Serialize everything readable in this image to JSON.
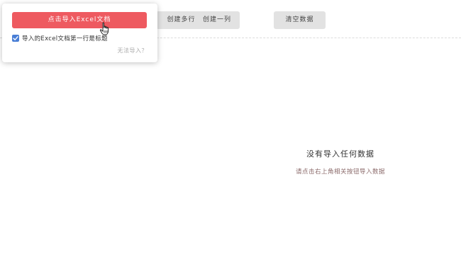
{
  "toolbar": {
    "buttons": [
      {
        "label": "创建多行"
      },
      {
        "label": "创建一列"
      },
      {
        "label": "清空数据"
      }
    ]
  },
  "popup": {
    "import_button_label": "点击导入Excel文档",
    "first_row_header_label": "导入的Excel文档第一行是标题",
    "first_row_header_checked": true,
    "help_link_label": "无法导入？"
  },
  "empty_state": {
    "title": "没有导入任何数据",
    "subtitle": "请点击右上角相关按钮导入数据"
  },
  "colors": {
    "primary": "#ee5a60",
    "checkbox": "#4a7fd6",
    "toolbar_button_bg": "#e2e2e2"
  }
}
